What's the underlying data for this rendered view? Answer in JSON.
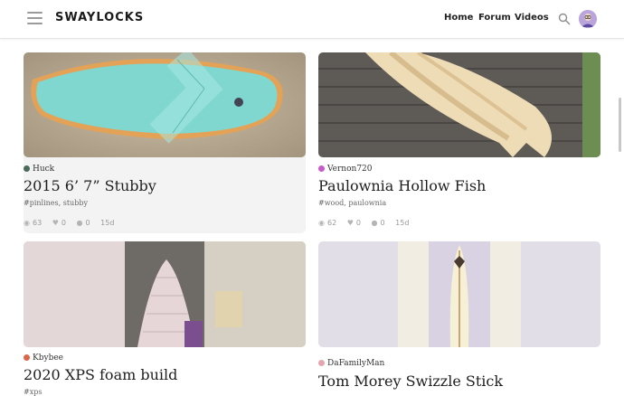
{
  "brand": {
    "logo_text": "SWAYLOCKS"
  },
  "nav": {
    "home": "Home",
    "forum": "Forum",
    "videos": "Videos"
  },
  "icons": {
    "menu": "hamburger-icon",
    "search": "search-icon",
    "eye": "eye-icon",
    "heart": "heart-icon",
    "comment": "comment-icon"
  },
  "cards": [
    {
      "author": "Huck",
      "author_color": "#4a6b5a",
      "title": "2015 6’ 7” Stubby",
      "tags": "#pinlines, stubby",
      "views": "63",
      "likes": "0",
      "replies": "0",
      "age": "15d"
    },
    {
      "author": "Vernon720",
      "author_color": "#c85bc8",
      "title": "Paulownia Hollow Fish",
      "tags": "#wood, paulownia",
      "views": "62",
      "likes": "0",
      "replies": "0",
      "age": "15d"
    },
    {
      "author": "Kbybee",
      "author_color": "#d9674a",
      "title": "2020 XPS foam build",
      "tags": "#xps"
    },
    {
      "author": "DaFamilyMan",
      "author_color": "#e4a5b0",
      "title": "Tom Morey Swizzle Stick"
    }
  ]
}
